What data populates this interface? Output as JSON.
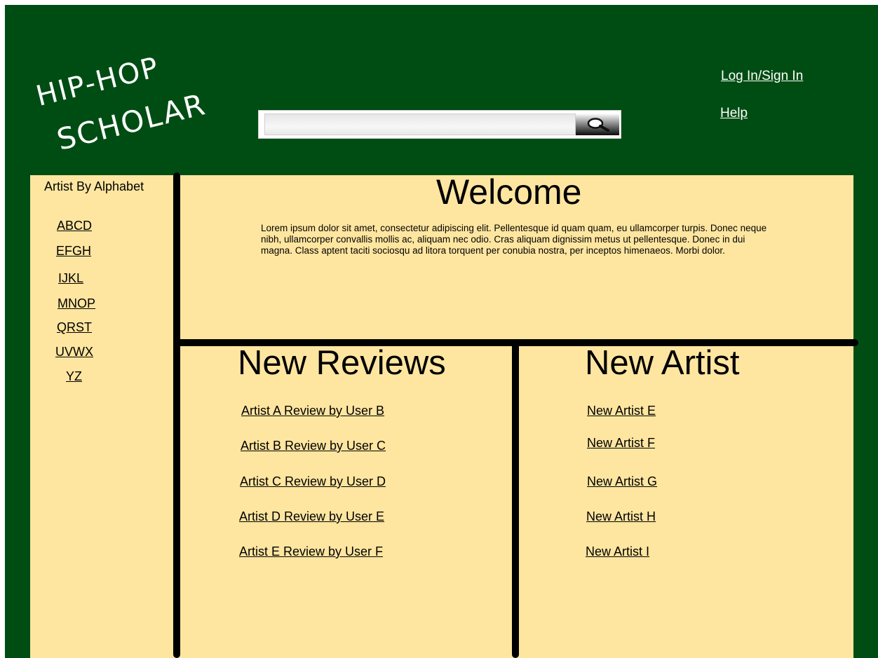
{
  "header": {
    "logo_line1": "HIP-HOP",
    "logo_line2": "SCHOLAR",
    "search": {
      "value": "",
      "placeholder": ""
    },
    "links": {
      "login": "Log In/Sign In",
      "help": "Help"
    }
  },
  "sidebar": {
    "title": "Artist By Alphabet",
    "items": [
      "ABCD",
      "EFGH",
      "IJKL",
      "MNOP",
      "QRST",
      "UVWX",
      "YZ"
    ]
  },
  "welcome": {
    "title": "Welcome",
    "body": "Lorem ipsum dolor sit amet, consectetur adipiscing elit. Pellentesque id quam quam, eu ullamcorper turpis. Donec neque nibh, ullamcorper convallis mollis ac, aliquam nec odio. Cras aliquam dignissim metus ut pellentesque. Donec in dui magna. Class aptent taciti sociosqu ad litora torquent per conubia nostra, per inceptos himenaeos. Morbi dolor."
  },
  "reviews": {
    "title": "New Reviews",
    "items": [
      "Artist A Review by User B",
      "Artist B Review by User C",
      "Artist C Review by User D",
      "Artist D Review by User E",
      "Artist E Review by User F"
    ]
  },
  "new_artist": {
    "title": "New Artist",
    "items": [
      "New Artist E",
      "New Artist F",
      "New Artist G",
      "New Artist H",
      "New Artist I"
    ]
  },
  "colors": {
    "header_green": "#004d13",
    "content_bg": "#ffe6a0",
    "divider": "#000000"
  }
}
